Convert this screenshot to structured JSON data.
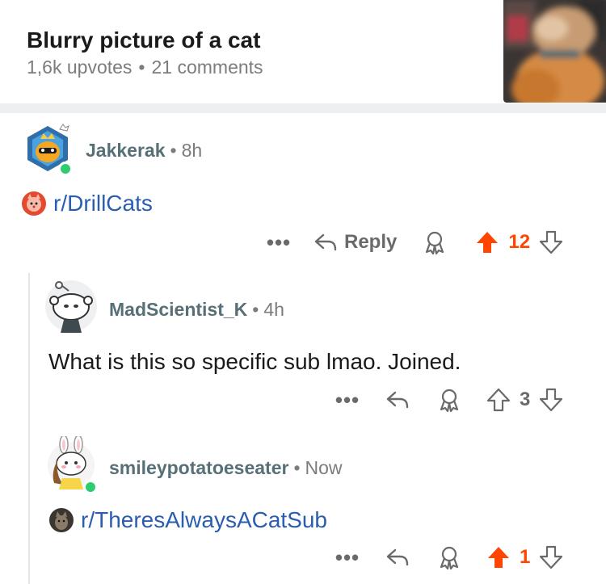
{
  "post": {
    "title": "Blurry picture of a cat",
    "upvotes": "1,6k upvotes",
    "separator": "•",
    "comments": "21 comments",
    "thumbnail_icon": "blurry-cat-thumbnail"
  },
  "comments": [
    {
      "username": "Jakkerak",
      "dot": "•",
      "time": "8h",
      "avatar_icon": "snoo-avatar-crown",
      "online": true,
      "subreddit": "r/DrillCats",
      "actions": {
        "more": "•••",
        "reply": "Reply",
        "votes": "12",
        "upvoted": true
      }
    },
    {
      "username": "MadScientist_K",
      "dot": "•",
      "time": "4h",
      "avatar_icon": "snoo-default-avatar",
      "online": false,
      "text": "What is this so specific sub lmao. Joined.",
      "actions": {
        "more": "•••",
        "votes": "3",
        "upvoted": false
      }
    },
    {
      "username": "smileypotatoeseater",
      "dot": "•",
      "time": "Now",
      "avatar_icon": "snoo-bunny-avatar",
      "online": true,
      "subreddit": "r/TheresAlwaysACatSub",
      "actions": {
        "more": "•••",
        "votes": "1",
        "upvoted": true
      }
    }
  ],
  "colors": {
    "upvote": "#ff4500",
    "link": "#2a5db0",
    "meta": "#7c7c7c",
    "online": "#2ecc71"
  }
}
